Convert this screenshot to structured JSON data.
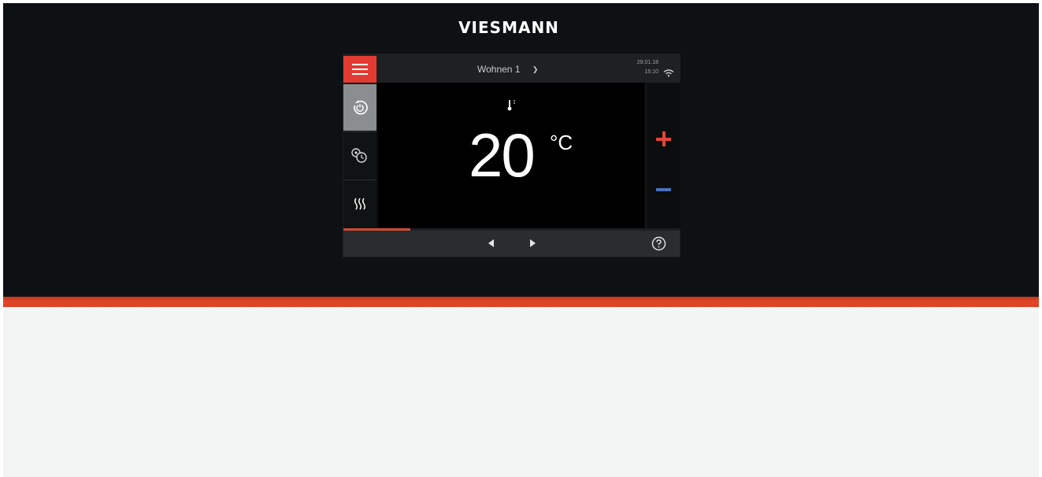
{
  "brand": {
    "logo_text": "VIESMANN"
  },
  "header": {
    "zone_label": "Wohnen 1",
    "date": "29.01.18",
    "time": "15:10",
    "menu_icon": "hamburger-menu-icon",
    "zone_icon": "chevron-down-icon",
    "status_icon": "wifi-icon"
  },
  "sidebar": {
    "items": [
      {
        "icon": "power-mode-icon",
        "active": true
      },
      {
        "icon": "time-program-icon",
        "active": false
      },
      {
        "icon": "heating-icon",
        "active": false
      }
    ]
  },
  "main": {
    "sensor_icon": "thermometer-icon",
    "temperature": "20",
    "unit": "°C"
  },
  "controls": {
    "increase_icon": "plus-icon",
    "decrease_icon": "minus-icon"
  },
  "progress": {
    "value": 0.2
  },
  "footer": {
    "prev_icon": "arrow-left-icon",
    "next_icon": "arrow-right-icon",
    "help_icon": "help-icon"
  },
  "colors": {
    "accent_red": "#e33b32",
    "stripe_orange": "#e2472a",
    "minus_blue": "#4b6fbd",
    "panel_dark": "#0d1114"
  }
}
